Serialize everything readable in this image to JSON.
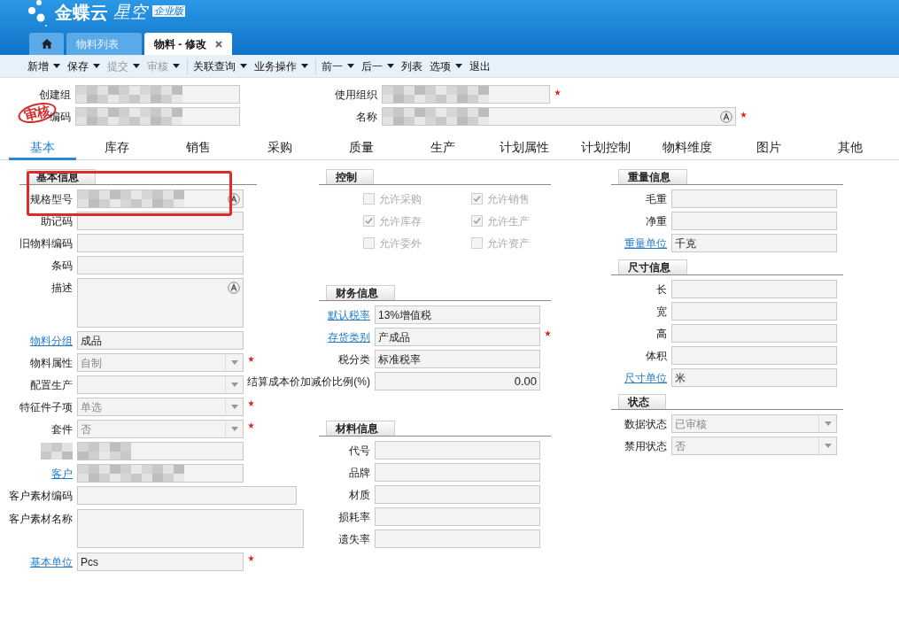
{
  "app": {
    "brand": "金蝶云",
    "product": "星空",
    "edition": "企业版"
  },
  "window_tabs": [
    {
      "kind": "home",
      "selected": false
    },
    {
      "kind": "page",
      "label": "物料列表",
      "selected": false,
      "closable": false
    },
    {
      "kind": "page",
      "label": "物料 - 修改",
      "selected": true,
      "closable": true
    }
  ],
  "toolbar": [
    [
      {
        "label": "新增",
        "dropdown": true,
        "disabled": false
      },
      {
        "label": "保存",
        "dropdown": true,
        "disabled": false
      },
      {
        "label": "提交",
        "dropdown": true,
        "disabled": true
      },
      {
        "label": "审核",
        "dropdown": true,
        "disabled": true
      }
    ],
    [
      {
        "label": "关联查询",
        "dropdown": true,
        "disabled": false
      },
      {
        "label": "业务操作",
        "dropdown": true,
        "disabled": false
      }
    ],
    [
      {
        "label": "前一",
        "dropdown": true,
        "disabled": false
      },
      {
        "label": "后一",
        "dropdown": true,
        "disabled": false
      },
      {
        "label": "列表",
        "dropdown": false,
        "disabled": false
      },
      {
        "label": "选项",
        "dropdown": true,
        "disabled": false
      },
      {
        "label": "退出",
        "dropdown": false,
        "disabled": false
      }
    ]
  ],
  "header_fields": [
    {
      "label": "创建组",
      "kind": "redacted",
      "required": false,
      "multilang": false
    },
    {
      "label": "使用组织",
      "kind": "redacted",
      "required": true,
      "multilang": false
    },
    {
      "label": "编码",
      "kind": "redacted",
      "required": false,
      "multilang": false
    },
    {
      "label": "名称",
      "kind": "redacted",
      "required": true,
      "multilang": true
    }
  ],
  "stamp": "审核",
  "form_tabs": [
    {
      "label": "基本",
      "selected": true
    },
    {
      "label": "库存",
      "selected": false
    },
    {
      "label": "销售",
      "selected": false
    },
    {
      "label": "采购",
      "selected": false
    },
    {
      "label": "质量",
      "selected": false
    },
    {
      "label": "生产",
      "selected": false
    },
    {
      "label": "计划属性",
      "selected": false
    },
    {
      "label": "计划控制",
      "selected": false
    },
    {
      "label": "物料维度",
      "selected": false
    },
    {
      "label": "图片",
      "selected": false
    },
    {
      "label": "其他",
      "selected": false
    }
  ],
  "columns": [
    {
      "sections": [
        {
          "title": "基本信息",
          "rows": [
            {
              "label": "规格型号",
              "link": false,
              "kind": "redacted",
              "required": false,
              "multilang": true
            },
            {
              "label": "助记码",
              "link": false,
              "kind": "text",
              "required": false,
              "multilang": false
            },
            {
              "label": "旧物料编码",
              "link": false,
              "kind": "text",
              "required": false,
              "multilang": false
            },
            {
              "label": "条码",
              "link": false,
              "kind": "text",
              "required": false,
              "multilang": false
            },
            {
              "label": "描述",
              "link": false,
              "kind": "textarea",
              "required": false,
              "multilang": true
            },
            {
              "label": "物料分组",
              "link": true,
              "kind": "text",
              "value": "成品",
              "required": false,
              "multilang": false
            },
            {
              "label": "物料属性",
              "link": false,
              "kind": "select",
              "value": "自制",
              "disabled": true,
              "required": true,
              "multilang": false
            },
            {
              "label": "配置生产",
              "link": false,
              "kind": "select",
              "disabled": true,
              "required": false,
              "multilang": false
            },
            {
              "label": "特征件子项",
              "link": false,
              "kind": "select",
              "value": "单选",
              "disabled": true,
              "required": true,
              "multilang": false
            },
            {
              "label": "套件",
              "link": false,
              "kind": "select",
              "value": "否",
              "disabled": true,
              "required": true,
              "multilang": false
            },
            {
              "kind": "redacted",
              "required": false,
              "multilang": false
            },
            {
              "label": "客户",
              "link": true,
              "kind": "redacted",
              "required": false,
              "multilang": false
            },
            {
              "label": "客户素材编码",
              "link": false,
              "kind": "text",
              "wide": true,
              "required": false,
              "multilang": false
            },
            {
              "label": "客户素材名称",
              "link": false,
              "kind": "textarea",
              "wide": true,
              "required": false,
              "multilang": false
            },
            {
              "label": "基本单位",
              "link": true,
              "kind": "text",
              "value": "Pcs",
              "required": true,
              "multilang": false
            }
          ]
        }
      ]
    },
    {
      "sections": [
        {
          "title": "控制",
          "checkboxes": [
            {
              "label": "允许采购",
              "checked": false,
              "disabled": true
            },
            {
              "label": "允许销售",
              "checked": true,
              "disabled": true
            },
            {
              "label": "允许库存",
              "checked": true,
              "disabled": true
            },
            {
              "label": "允许生产",
              "checked": true,
              "disabled": true
            },
            {
              "label": "允许委外",
              "checked": false,
              "disabled": true
            },
            {
              "label": "允许资产",
              "checked": false,
              "disabled": true
            }
          ]
        },
        {
          "title": "财务信息",
          "rows": [
            {
              "label": "默认税率",
              "link": true,
              "kind": "text",
              "value": "13%增值税",
              "required": false,
              "multilang": false
            },
            {
              "label": "存货类别",
              "link": true,
              "kind": "text",
              "value": "产成品",
              "required": true,
              "multilang": false
            },
            {
              "label": "税分类",
              "link": false,
              "kind": "text",
              "value": "标准税率",
              "required": false,
              "multilang": false
            },
            {
              "label": "结算成本价加减价比例(%)",
              "link": false,
              "kind": "number",
              "value": "0.00",
              "required": false,
              "multilang": false
            }
          ]
        },
        {
          "title": "材料信息",
          "rows": [
            {
              "label": "代号",
              "link": false,
              "kind": "text",
              "required": false,
              "multilang": false
            },
            {
              "label": "品牌",
              "link": false,
              "kind": "text",
              "required": false,
              "multilang": false
            },
            {
              "label": "材质",
              "link": false,
              "kind": "text",
              "required": false,
              "multilang": false
            },
            {
              "label": "损耗率",
              "link": false,
              "kind": "text",
              "required": false,
              "multilang": false
            },
            {
              "label": "遗失率",
              "link": false,
              "kind": "text",
              "required": false,
              "multilang": false
            }
          ]
        }
      ]
    },
    {
      "sections": [
        {
          "title": "重量信息",
          "rows": [
            {
              "label": "毛重",
              "link": false,
              "kind": "text",
              "required": false,
              "multilang": false
            },
            {
              "label": "净重",
              "link": false,
              "kind": "text",
              "required": false,
              "multilang": false
            },
            {
              "label": "重量单位",
              "link": true,
              "kind": "text",
              "value": "千克",
              "required": false,
              "multilang": false
            }
          ]
        },
        {
          "title": "尺寸信息",
          "rows": [
            {
              "label": "长",
              "link": false,
              "kind": "text",
              "required": false,
              "multilang": false
            },
            {
              "label": "宽",
              "link": false,
              "kind": "text",
              "required": false,
              "multilang": false
            },
            {
              "label": "高",
              "link": false,
              "kind": "text",
              "required": false,
              "multilang": false
            },
            {
              "label": "体积",
              "link": false,
              "kind": "text",
              "required": false,
              "multilang": false
            },
            {
              "label": "尺寸单位",
              "link": true,
              "kind": "text",
              "value": "米",
              "required": false,
              "multilang": false
            }
          ]
        },
        {
          "title": "状态",
          "rows": [
            {
              "label": "数据状态",
              "link": false,
              "kind": "select",
              "value": "已审核",
              "disabled": true,
              "required": false,
              "multilang": false
            },
            {
              "label": "禁用状态",
              "link": false,
              "kind": "select",
              "value": "否",
              "disabled": true,
              "required": false,
              "multilang": false
            }
          ]
        }
      ]
    }
  ],
  "annotations": [
    {
      "kind": "highlight_box"
    }
  ]
}
